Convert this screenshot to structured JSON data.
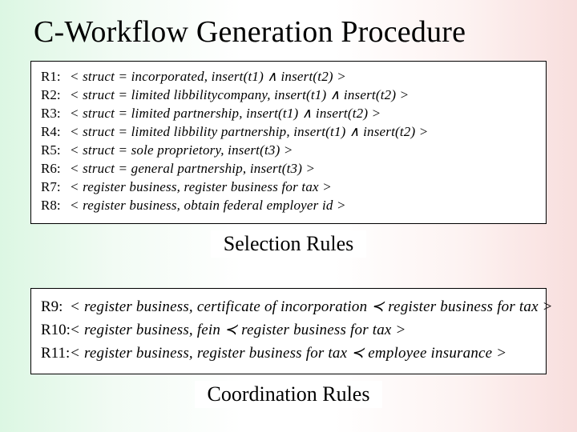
{
  "title": "C-Workflow Generation Procedure",
  "selection": {
    "rules": [
      {
        "label": "R1:",
        "expr": "< struct = incorporated, insert(t1) ∧ insert(t2) >"
      },
      {
        "label": "R2:",
        "expr": "< struct = limited libbilitycompany, insert(t1) ∧ insert(t2) >"
      },
      {
        "label": "R3:",
        "expr": "< struct = limited partnership, insert(t1) ∧ insert(t2) >"
      },
      {
        "label": "R4:",
        "expr": "< struct = limited libbility partnership, insert(t1) ∧ insert(t2) >"
      },
      {
        "label": "R5:",
        "expr": "< struct = sole proprietory, insert(t3) >"
      },
      {
        "label": "R6:",
        "expr": "< struct = general partnership, insert(t3) >"
      },
      {
        "label": "R7:",
        "expr": "< register business, register business for tax >"
      },
      {
        "label": "R8:",
        "expr": "< register business, obtain federal employer id >"
      }
    ],
    "caption": "Selection Rules"
  },
  "coordination": {
    "rules": [
      {
        "label": "R9:",
        "expr": "< register business, certificate of incorporation ≺ register business for tax >"
      },
      {
        "label": "R10:",
        "expr": "< register business, fein ≺ register business for tax >"
      },
      {
        "label": "R11:",
        "expr": "< register business, register business for tax ≺ employee insurance >"
      }
    ],
    "caption": "Coordination Rules"
  }
}
